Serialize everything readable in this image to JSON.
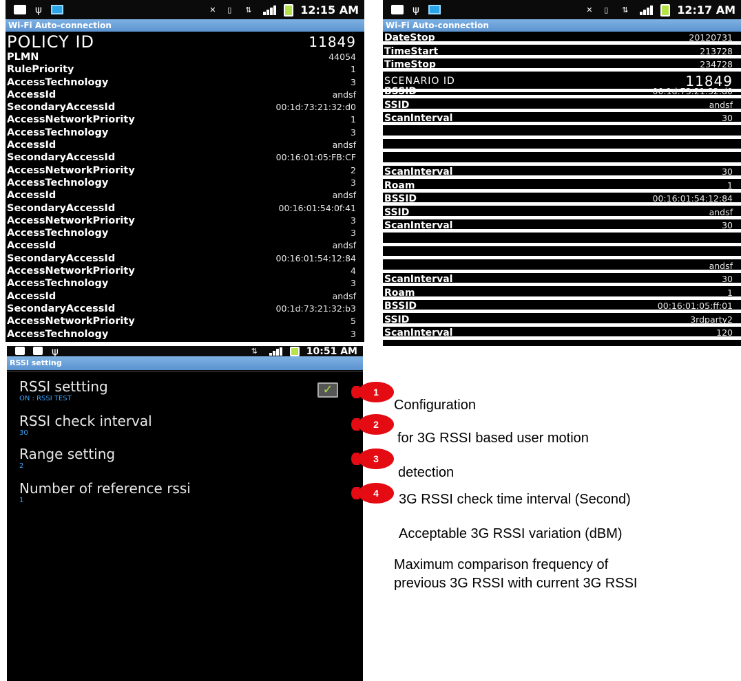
{
  "screen_policy": {
    "status_time": "12:15 AM",
    "title": "Wi-Fi Auto-connection",
    "rows": [
      {
        "key": "POLICY ID",
        "value": "11849",
        "big": true
      },
      {
        "key": "PLMN",
        "value": "44054"
      },
      {
        "key": "RulePriority",
        "value": "1"
      },
      {
        "key": "AccessTechnology",
        "value": "3"
      },
      {
        "key": "AccessId",
        "value": "andsf"
      },
      {
        "key": "SecondaryAccessId",
        "value": "00:1d:73:21:32:d0"
      },
      {
        "key": "AccessNetworkPriority",
        "value": "1"
      },
      {
        "key": "AccessTechnology",
        "value": "3"
      },
      {
        "key": "AccessId",
        "value": "andsf"
      },
      {
        "key": "SecondaryAccessId",
        "value": "00:16:01:05:FB:CF"
      },
      {
        "key": "AccessNetworkPriority",
        "value": "2"
      },
      {
        "key": "AccessTechnology",
        "value": "3"
      },
      {
        "key": "AccessId",
        "value": "andsf"
      },
      {
        "key": "SecondaryAccessId",
        "value": "00:16:01:54:0f:41"
      },
      {
        "key": "AccessNetworkPriority",
        "value": "3"
      },
      {
        "key": "AccessTechnology",
        "value": "3"
      },
      {
        "key": "AccessId",
        "value": "andsf"
      },
      {
        "key": "SecondaryAccessId",
        "value": "00:16:01:54:12:84"
      },
      {
        "key": "AccessNetworkPriority",
        "value": "4"
      },
      {
        "key": "AccessTechnology",
        "value": "3"
      },
      {
        "key": "AccessId",
        "value": "andsf"
      },
      {
        "key": "SecondaryAccessId",
        "value": "00:1d:73:21:32:b3"
      },
      {
        "key": "AccessNetworkPriority",
        "value": "5"
      },
      {
        "key": "AccessTechnology",
        "value": "3"
      }
    ]
  },
  "screen_scenario": {
    "status_time": "12:17 AM",
    "title": "Wi-Fi Auto-connection",
    "rows": [
      {
        "key": "DateStop",
        "value": "20120731"
      },
      {
        "key": "TimeStart",
        "value": "213728"
      },
      {
        "key": "TimeStop",
        "value": "234728"
      },
      {
        "key": "SCENARIO ID",
        "value": "11849",
        "big": true
      },
      {
        "key": "BSSID",
        "value": "00:1d:73:21:32:d0"
      },
      {
        "key": "SSID",
        "value": "andsf"
      },
      {
        "key": "ScanInterval",
        "value": "30"
      },
      {
        "key": "",
        "value": ""
      },
      {
        "key": "",
        "value": ""
      },
      {
        "key": "",
        "value": ""
      },
      {
        "key": "ScanInterval",
        "value": "30"
      },
      {
        "key": "Roam",
        "value": "1"
      },
      {
        "key": "BSSID",
        "value": "00:16:01:54:12:84"
      },
      {
        "key": "SSID",
        "value": "andsf"
      },
      {
        "key": "ScanInterval",
        "value": "30"
      },
      {
        "key": "",
        "value": ""
      },
      {
        "key": "",
        "value": ""
      },
      {
        "key": "",
        "value": "andsf"
      },
      {
        "key": "ScanInterval",
        "value": "30"
      },
      {
        "key": "Roam",
        "value": "1"
      },
      {
        "key": "BSSID",
        "value": "00:16:01:05:ff:01"
      },
      {
        "key": "SSID",
        "value": "3rdparty2"
      },
      {
        "key": "ScanInterval",
        "value": "120"
      }
    ]
  },
  "screen_rssi": {
    "status_time": "10:51 AM",
    "title": "RSSI setting",
    "settings": [
      {
        "name": "RSSI settting",
        "sub": "ON : RSSI TEST",
        "checked": true
      },
      {
        "name": "RSSI check interval",
        "sub": "30"
      },
      {
        "name": "Range setting",
        "sub": "2"
      },
      {
        "name": "Number of reference rssi",
        "sub": "1"
      }
    ]
  },
  "annotations": {
    "badges": [
      "1",
      "2",
      "3",
      "4"
    ],
    "lines": [
      "Configuration",
      "for 3G RSSI based user motion",
      "detection",
      "3G RSSI check time interval (Second)",
      "Acceptable 3G RSSI variation (dBM)",
      "Maximum comparison frequency of",
      "previous 3G RSSI with current 3G RSSI"
    ]
  },
  "colors": {
    "badge": "#e40b12",
    "titlebar": "#6fa6dc",
    "sub_text": "#3fa5ff",
    "check": "#a8e23a"
  }
}
